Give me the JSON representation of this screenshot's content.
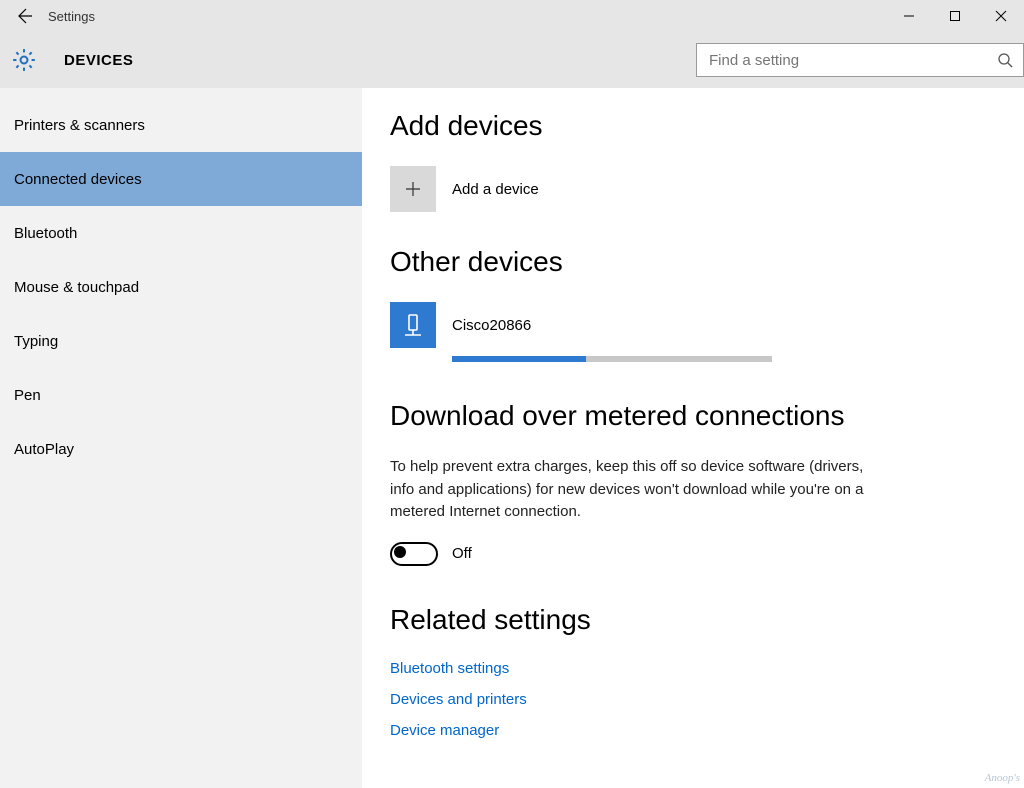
{
  "titlebar": {
    "title": "Settings"
  },
  "header": {
    "section_title": "DEVICES",
    "search_placeholder": "Find a setting"
  },
  "sidebar": {
    "items": [
      {
        "label": "Printers & scanners"
      },
      {
        "label": "Connected devices"
      },
      {
        "label": "Bluetooth"
      },
      {
        "label": "Mouse & touchpad"
      },
      {
        "label": "Typing"
      },
      {
        "label": "Pen"
      },
      {
        "label": "AutoPlay"
      }
    ],
    "selected_index": 1
  },
  "main": {
    "add_devices_heading": "Add devices",
    "add_device_label": "Add a device",
    "other_devices_heading": "Other devices",
    "device": {
      "name": "Cisco20866",
      "progress_pct": 42
    },
    "metered_heading": "Download over metered connections",
    "metered_desc": "To help prevent extra charges, keep this off so device software (drivers, info and applications) for new devices won't download while you're on a metered Internet connection.",
    "metered_toggle_state": "Off",
    "related_heading": "Related settings",
    "links": [
      "Bluetooth settings",
      "Devices and printers",
      "Device manager"
    ]
  },
  "watermark": "Anoop's"
}
